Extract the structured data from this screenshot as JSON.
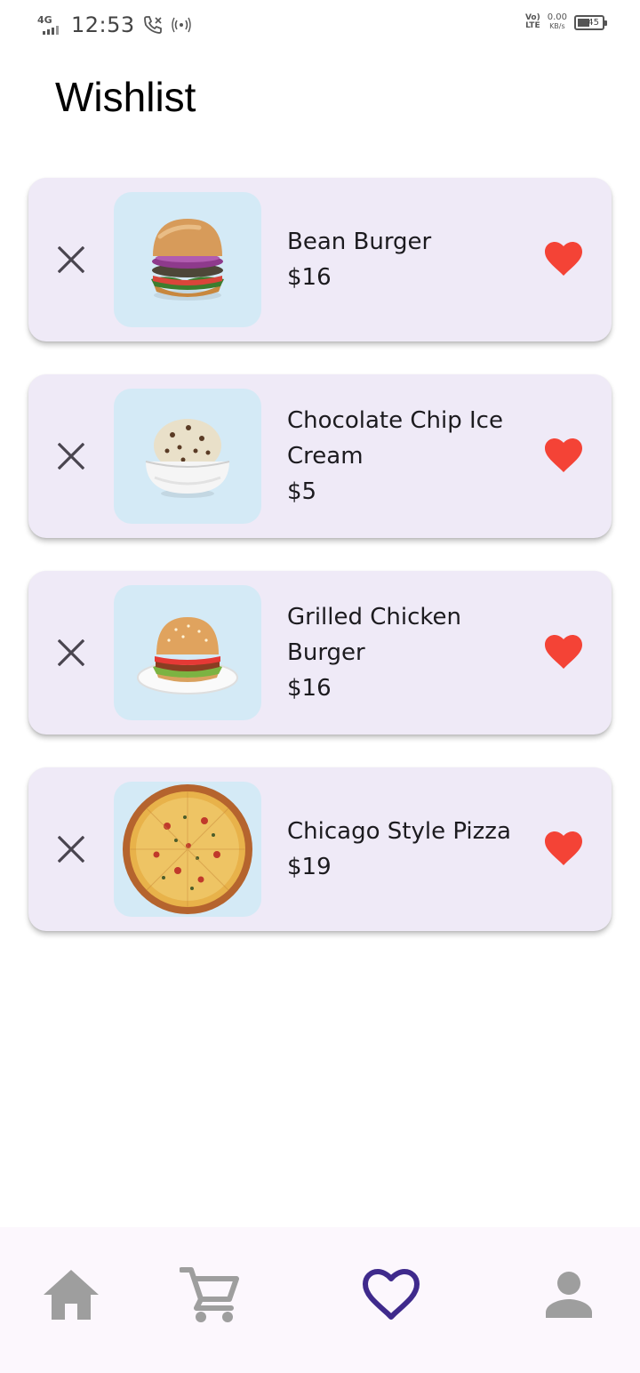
{
  "status_bar": {
    "network": "4G",
    "time": "12:53",
    "volte_top": "Vo)",
    "volte_bottom": "LTE",
    "speed_value": "0.00",
    "speed_unit": "KB/s",
    "battery": "45"
  },
  "page": {
    "title": "Wishlist"
  },
  "colors": {
    "card_bg": "#efeaf7",
    "thumb_bg": "#d4eaf6",
    "heart": "#f44336",
    "nav_active": "#3f2a8c",
    "nav_inactive": "#9e9e9e"
  },
  "wishlist": [
    {
      "name": "Bean Burger",
      "price": "$16",
      "image": "bean-burger"
    },
    {
      "name": "Chocolate Chip Ice Cream",
      "price": "$5",
      "image": "ice-cream"
    },
    {
      "name": "Grilled Chicken Burger",
      "price": "$16",
      "image": "chicken-burger"
    },
    {
      "name": "Chicago Style Pizza",
      "price": "$19",
      "image": "pizza"
    }
  ],
  "nav": [
    {
      "name": "home",
      "icon": "home-icon",
      "active": false
    },
    {
      "name": "cart",
      "icon": "cart-icon",
      "active": false
    },
    {
      "name": "wishlist",
      "icon": "heart-outline-icon",
      "active": true
    },
    {
      "name": "profile",
      "icon": "person-icon",
      "active": false
    }
  ]
}
